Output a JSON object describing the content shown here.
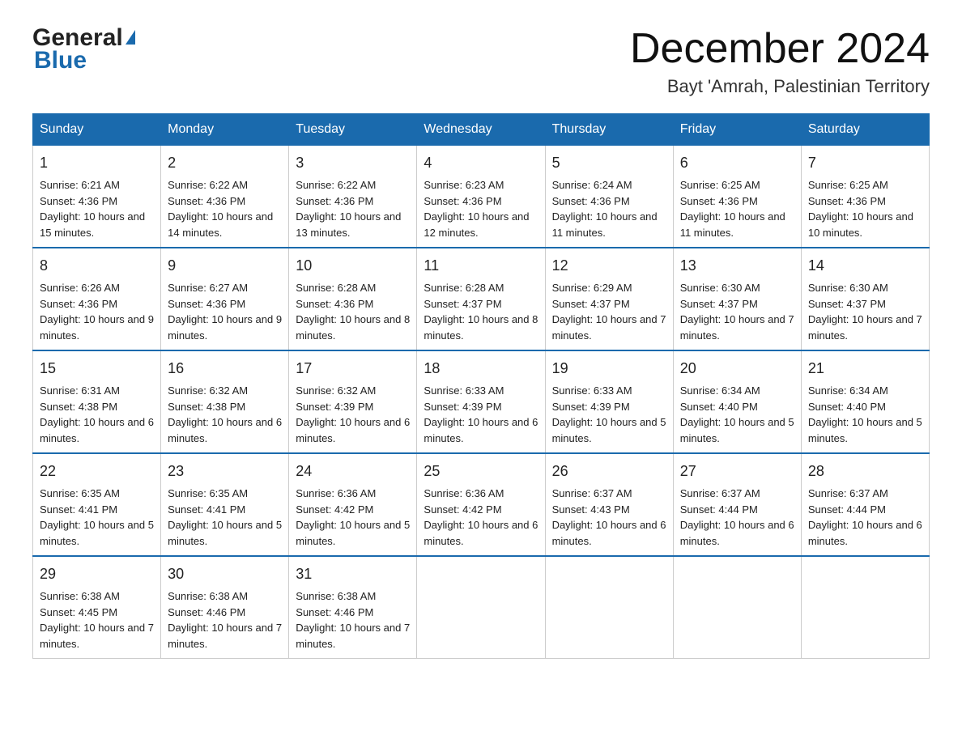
{
  "header": {
    "logo_general": "General",
    "logo_blue": "Blue",
    "month_title": "December 2024",
    "location": "Bayt 'Amrah, Palestinian Territory"
  },
  "weekdays": [
    "Sunday",
    "Monday",
    "Tuesday",
    "Wednesday",
    "Thursday",
    "Friday",
    "Saturday"
  ],
  "weeks": [
    [
      {
        "day": "1",
        "sunrise": "6:21 AM",
        "sunset": "4:36 PM",
        "daylight": "10 hours and 15 minutes."
      },
      {
        "day": "2",
        "sunrise": "6:22 AM",
        "sunset": "4:36 PM",
        "daylight": "10 hours and 14 minutes."
      },
      {
        "day": "3",
        "sunrise": "6:22 AM",
        "sunset": "4:36 PM",
        "daylight": "10 hours and 13 minutes."
      },
      {
        "day": "4",
        "sunrise": "6:23 AM",
        "sunset": "4:36 PM",
        "daylight": "10 hours and 12 minutes."
      },
      {
        "day": "5",
        "sunrise": "6:24 AM",
        "sunset": "4:36 PM",
        "daylight": "10 hours and 11 minutes."
      },
      {
        "day": "6",
        "sunrise": "6:25 AM",
        "sunset": "4:36 PM",
        "daylight": "10 hours and 11 minutes."
      },
      {
        "day": "7",
        "sunrise": "6:25 AM",
        "sunset": "4:36 PM",
        "daylight": "10 hours and 10 minutes."
      }
    ],
    [
      {
        "day": "8",
        "sunrise": "6:26 AM",
        "sunset": "4:36 PM",
        "daylight": "10 hours and 9 minutes."
      },
      {
        "day": "9",
        "sunrise": "6:27 AM",
        "sunset": "4:36 PM",
        "daylight": "10 hours and 9 minutes."
      },
      {
        "day": "10",
        "sunrise": "6:28 AM",
        "sunset": "4:36 PM",
        "daylight": "10 hours and 8 minutes."
      },
      {
        "day": "11",
        "sunrise": "6:28 AM",
        "sunset": "4:37 PM",
        "daylight": "10 hours and 8 minutes."
      },
      {
        "day": "12",
        "sunrise": "6:29 AM",
        "sunset": "4:37 PM",
        "daylight": "10 hours and 7 minutes."
      },
      {
        "day": "13",
        "sunrise": "6:30 AM",
        "sunset": "4:37 PM",
        "daylight": "10 hours and 7 minutes."
      },
      {
        "day": "14",
        "sunrise": "6:30 AM",
        "sunset": "4:37 PM",
        "daylight": "10 hours and 7 minutes."
      }
    ],
    [
      {
        "day": "15",
        "sunrise": "6:31 AM",
        "sunset": "4:38 PM",
        "daylight": "10 hours and 6 minutes."
      },
      {
        "day": "16",
        "sunrise": "6:32 AM",
        "sunset": "4:38 PM",
        "daylight": "10 hours and 6 minutes."
      },
      {
        "day": "17",
        "sunrise": "6:32 AM",
        "sunset": "4:39 PM",
        "daylight": "10 hours and 6 minutes."
      },
      {
        "day": "18",
        "sunrise": "6:33 AM",
        "sunset": "4:39 PM",
        "daylight": "10 hours and 6 minutes."
      },
      {
        "day": "19",
        "sunrise": "6:33 AM",
        "sunset": "4:39 PM",
        "daylight": "10 hours and 5 minutes."
      },
      {
        "day": "20",
        "sunrise": "6:34 AM",
        "sunset": "4:40 PM",
        "daylight": "10 hours and 5 minutes."
      },
      {
        "day": "21",
        "sunrise": "6:34 AM",
        "sunset": "4:40 PM",
        "daylight": "10 hours and 5 minutes."
      }
    ],
    [
      {
        "day": "22",
        "sunrise": "6:35 AM",
        "sunset": "4:41 PM",
        "daylight": "10 hours and 5 minutes."
      },
      {
        "day": "23",
        "sunrise": "6:35 AM",
        "sunset": "4:41 PM",
        "daylight": "10 hours and 5 minutes."
      },
      {
        "day": "24",
        "sunrise": "6:36 AM",
        "sunset": "4:42 PM",
        "daylight": "10 hours and 5 minutes."
      },
      {
        "day": "25",
        "sunrise": "6:36 AM",
        "sunset": "4:42 PM",
        "daylight": "10 hours and 6 minutes."
      },
      {
        "day": "26",
        "sunrise": "6:37 AM",
        "sunset": "4:43 PM",
        "daylight": "10 hours and 6 minutes."
      },
      {
        "day": "27",
        "sunrise": "6:37 AM",
        "sunset": "4:44 PM",
        "daylight": "10 hours and 6 minutes."
      },
      {
        "day": "28",
        "sunrise": "6:37 AM",
        "sunset": "4:44 PM",
        "daylight": "10 hours and 6 minutes."
      }
    ],
    [
      {
        "day": "29",
        "sunrise": "6:38 AM",
        "sunset": "4:45 PM",
        "daylight": "10 hours and 7 minutes."
      },
      {
        "day": "30",
        "sunrise": "6:38 AM",
        "sunset": "4:46 PM",
        "daylight": "10 hours and 7 minutes."
      },
      {
        "day": "31",
        "sunrise": "6:38 AM",
        "sunset": "4:46 PM",
        "daylight": "10 hours and 7 minutes."
      },
      null,
      null,
      null,
      null
    ]
  ],
  "labels": {
    "sunrise": "Sunrise:",
    "sunset": "Sunset:",
    "daylight": "Daylight:"
  }
}
